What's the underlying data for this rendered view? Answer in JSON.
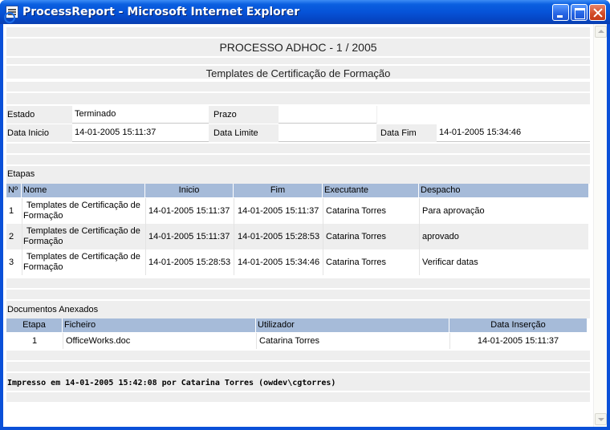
{
  "window": {
    "title": "ProcessReport - Microsoft Internet Explorer"
  },
  "report": {
    "title": "PROCESSO ADHOC - 1 / 2005",
    "subtitle": "Templates de Certificação de Formação",
    "info": {
      "estado_label": "Estado",
      "estado_value": "Terminado",
      "prazo_label": "Prazo",
      "prazo_value": "",
      "data_inicio_label": "Data Inicio",
      "data_inicio_value": "14-01-2005 15:11:37",
      "data_limite_label": "Data Limite",
      "data_limite_value": "",
      "data_fim_label": "Data Fim",
      "data_fim_value": "14-01-2005 15:34:46"
    },
    "etapas": {
      "section_title": "Etapas",
      "columns": [
        "Nº",
        "Nome",
        "Inicio",
        "Fim",
        "Executante",
        "Despacho"
      ],
      "rows": [
        {
          "n": "1",
          "nome_l1": "Templates de Certificação de",
          "nome_l2": "Formação",
          "inicio": "14-01-2005 15:11:37",
          "fim": "14-01-2005 15:11:37",
          "executante": "Catarina Torres",
          "despacho": "Para aprovação"
        },
        {
          "n": "2",
          "nome_l1": "Templates de Certificação de",
          "nome_l2": "Formação",
          "inicio": "14-01-2005 15:11:37",
          "fim": "14-01-2005 15:28:53",
          "executante": "Catarina Torres",
          "despacho": "aprovado"
        },
        {
          "n": "3",
          "nome_l1": "Templates de Certificação de",
          "nome_l2": "Formação",
          "inicio": "14-01-2005 15:28:53",
          "fim": "14-01-2005 15:34:46",
          "executante": "Catarina Torres",
          "despacho": "Verificar datas"
        }
      ]
    },
    "documentos": {
      "section_title": "Documentos Anexados",
      "columns": [
        "Etapa",
        "Ficheiro",
        "Utilizador",
        "Data Inserção"
      ],
      "rows": [
        {
          "etapa": "1",
          "ficheiro": "OfficeWorks.doc",
          "utilizador": "Catarina Torres",
          "data": "14-01-2005 15:11:37"
        }
      ]
    },
    "footer": "Impresso em 14-01-2005 15:42:08 por Catarina Torres (owdev\\cgtorres)"
  },
  "icons": {
    "window_icon": "ie-page-icon",
    "minimize": "minimize-icon",
    "maximize": "maximize-icon",
    "close": "close-icon",
    "scroll_up": "scroll-up-icon",
    "scroll_down": "scroll-down-icon"
  },
  "colors": {
    "titlebar": "#0a5fe0",
    "band": "#eeeeee",
    "table_header": "#a6bbd9",
    "close_button": "#d14a26"
  }
}
